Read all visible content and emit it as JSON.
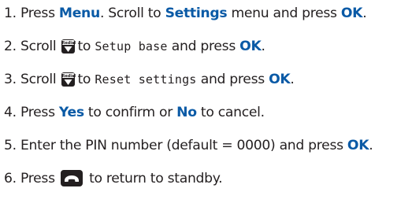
{
  "steps": [
    {
      "num": "1.",
      "t1": "Press ",
      "k1": "Menu",
      "t2": ". Scroll to ",
      "k2": "Settings",
      "t3": " menu and press ",
      "k3": "OK",
      "t4": "."
    },
    {
      "num": "2.",
      "t1": "Scroll",
      "key_label": "Redial",
      "t2": "to ",
      "lcd": "Setup base",
      "t3": " and press ",
      "k1": "OK",
      "t4": "."
    },
    {
      "num": "3.",
      "t1": "Scroll",
      "key_label": "Redial",
      "t2": "to ",
      "lcd": "Reset settings",
      "t3": " and press ",
      "k1": "OK",
      "t4": "."
    },
    {
      "num": "4.",
      "t1": "Press ",
      "k1": "Yes",
      "t2": " to confirm or ",
      "k2": "No",
      "t3": " to cancel."
    },
    {
      "num": "5.",
      "t1": "Enter the PIN number (default = 0000) and press ",
      "k1": "OK",
      "t2": "."
    },
    {
      "num": "6.",
      "t1": "Press",
      "t2": "to return to standby."
    }
  ],
  "icons": {
    "redial_key": "redial-down-arrow-icon",
    "end_key": "end-call-handset-icon"
  },
  "colors": {
    "text": "#231f20",
    "keyword": "#0a5aa6",
    "key_background": "#231f20"
  }
}
